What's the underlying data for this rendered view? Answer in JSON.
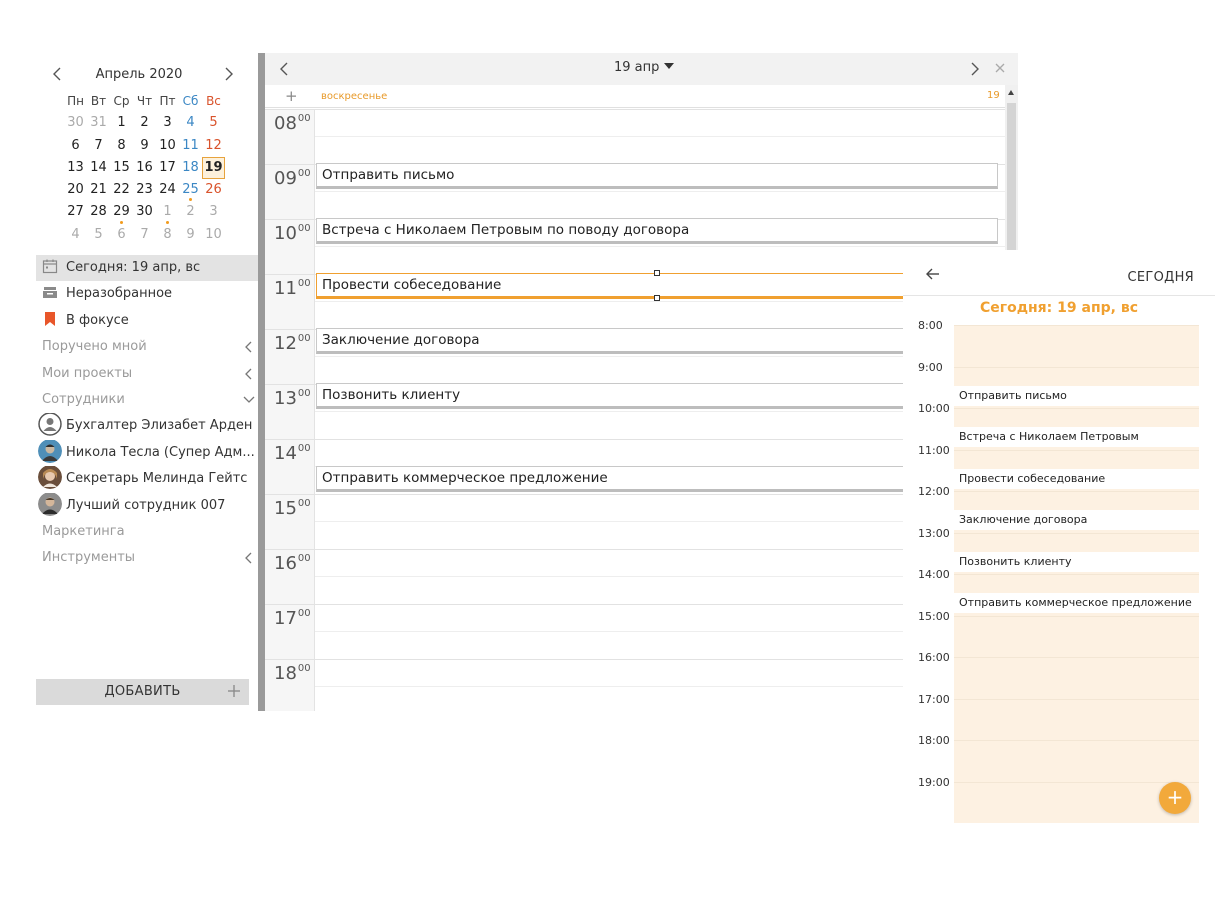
{
  "mini_calendar": {
    "title": "Апрель 2020",
    "weekdays": [
      "Пн",
      "Вт",
      "Ср",
      "Чт",
      "Пт",
      "Сб",
      "Вс"
    ],
    "weeks": [
      [
        "30",
        "31",
        "1",
        "2",
        "3",
        "4",
        "5"
      ],
      [
        "6",
        "7",
        "8",
        "9",
        "10",
        "11",
        "12"
      ],
      [
        "13",
        "14",
        "15",
        "16",
        "17",
        "18",
        "19"
      ],
      [
        "20",
        "21",
        "22",
        "23",
        "24",
        "25",
        "26"
      ],
      [
        "27",
        "28",
        "29",
        "30",
        "1",
        "2",
        "3"
      ],
      [
        "4",
        "5",
        "6",
        "7",
        "8",
        "9",
        "10"
      ]
    ],
    "today": "19",
    "days_with_events": [
      "25",
      "29",
      "1"
    ]
  },
  "sidebar": {
    "today_item": "Сегодня: 19 апр, вс",
    "inbox_item": "Неразобранное",
    "focus_item": "В фокусе",
    "assigned_section": "Поручено мной",
    "projects_section": "Мои проекты",
    "employees_section": "Сотрудники",
    "people": [
      "Бухгалтер Элизабет Арден",
      "Никола Тесла (Супер Адм...",
      "Секретарь Мелинда Гейтс",
      "Лучший сотрудник 007"
    ],
    "marketing_section": "Маркетинга",
    "tools_section": "Инструменты",
    "add_button": "ДОБАВИТЬ"
  },
  "day_view": {
    "date_selector": "19 апр",
    "allday_plus": "+",
    "day_name": "воскресенье",
    "day_number": "19",
    "hours": [
      "08",
      "09",
      "10",
      "11",
      "12",
      "13",
      "14",
      "15",
      "16",
      "17",
      "18"
    ],
    "minutes_label": "00",
    "events": [
      "Отправить письмо",
      "Встреча с Николаем Петровым по поводу договора",
      "Провести собеседование",
      "Заключение договора",
      "Позвонить клиенту",
      "Отправить коммерческое предложение"
    ]
  },
  "mobile": {
    "header_title": "СЕГОДНЯ",
    "today_label": "Сегодня: 19 апр, вс",
    "times": [
      "8:00",
      "9:00",
      "10:00",
      "11:00",
      "12:00",
      "13:00",
      "14:00",
      "15:00",
      "16:00",
      "17:00",
      "18:00",
      "19:00"
    ],
    "events": [
      "Отправить письмо",
      "Встреча с Николаем Петровым",
      "Провести собеседование",
      "Заключение договора",
      "Позвонить клиенту",
      "Отправить коммерческое предложение"
    ],
    "fab_label": "+"
  },
  "colors": {
    "accent_orange": "#f0a030",
    "saturday_blue": "#3b87c4",
    "sunday_red": "#d9532c",
    "mobile_slot_bg": "#fdf1e2"
  }
}
